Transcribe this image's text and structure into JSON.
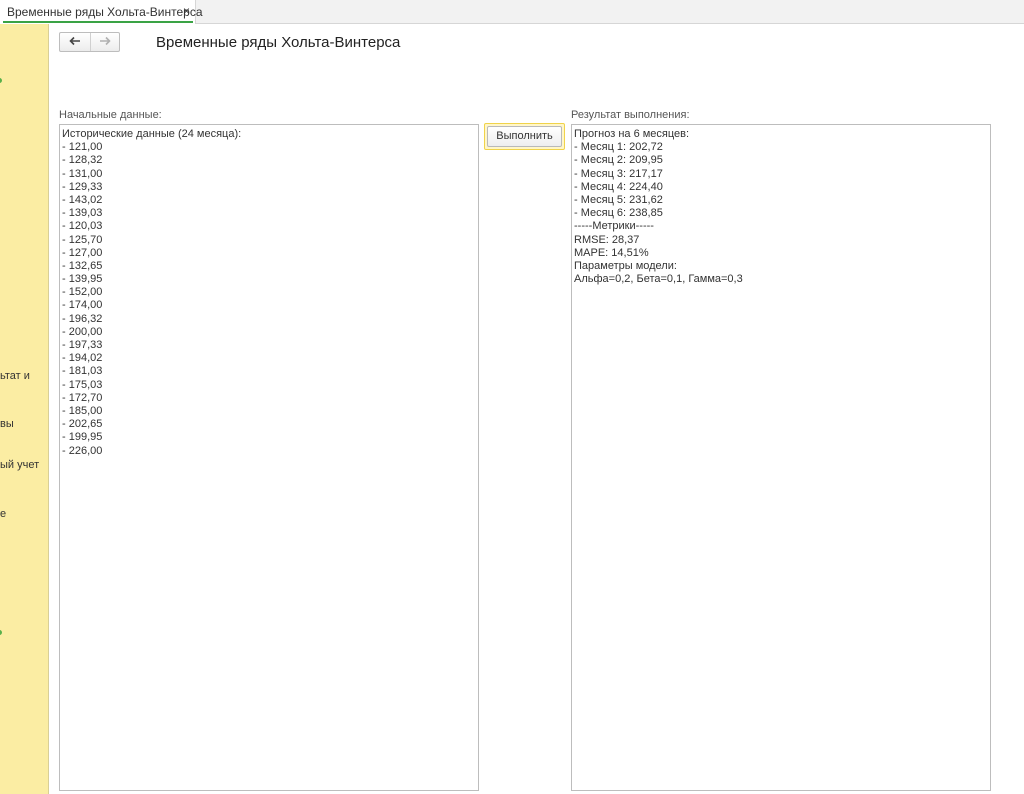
{
  "tab": {
    "title": "Временные ряды Хольта-Винтерса",
    "close_glyph": "×"
  },
  "sidebar": {
    "items": [
      "ьтат и",
      "вы",
      "ый учет",
      "е"
    ]
  },
  "nav": {
    "back_icon": "arrow-left-icon",
    "forward_icon": "arrow-right-icon",
    "back_glyph": "🡐",
    "forward_glyph": "🡒"
  },
  "page": {
    "title": "Временные ряды Хольта-Винтерса"
  },
  "input": {
    "label": "Начальные данные:",
    "lines": [
      "Исторические данные (24 месяца):",
      "- 121,00",
      "- 128,32",
      "- 131,00",
      "- 129,33",
      "- 143,02",
      "- 139,03",
      "- 120,03",
      "- 125,70",
      "- 127,00",
      "- 132,65",
      "- 139,95",
      "- 152,00",
      "- 174,00",
      "- 196,32",
      "- 200,00",
      "- 197,33",
      "- 194,02",
      "- 181,03",
      "- 175,03",
      "- 172,70",
      "- 185,00",
      "- 202,65",
      "- 199,95",
      "- 226,00"
    ]
  },
  "actions": {
    "run_label": "Выполнить"
  },
  "result": {
    "label": "Результат выполнения:",
    "lines": [
      "Прогноз на 6 месяцев:",
      "- Месяц 1: 202,72",
      "- Месяц 2: 209,95",
      "- Месяц 3: 217,17",
      "- Месяц 4: 224,40",
      "- Месяц 5: 231,62",
      "- Месяц 6: 238,85",
      "-----Метрики-----",
      "RMSE: 28,37",
      "MAPE: 14,51%",
      "Параметры модели:",
      "Альфа=0,2, Бета=0,1, Гамма=0,3"
    ]
  },
  "colors": {
    "sidebar_bg": "#fbeda3",
    "tab_accent": "#3aa345",
    "button_focus": "#f0d34a"
  }
}
